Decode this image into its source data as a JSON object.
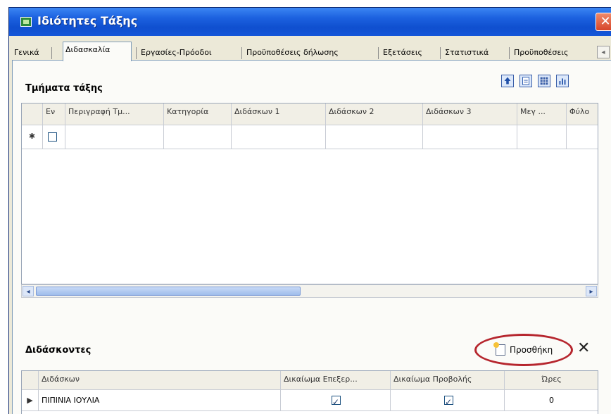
{
  "window": {
    "title": "Ιδιότητες Τάξης",
    "close_glyph": "✕"
  },
  "tabs": [
    {
      "label": "Γενικά"
    },
    {
      "label": "Διδασκαλία"
    },
    {
      "label": "Εργασίες-Πρόοδοι"
    },
    {
      "label": "Προϋποθέσεις δήλωσης"
    },
    {
      "label": "Εξετάσεις"
    },
    {
      "label": "Στατιστικά"
    },
    {
      "label": "Προϋποθέσεις"
    }
  ],
  "tabs_scroll_glyph": "◂",
  "tmimata": {
    "title": "Τμήματα τάξης",
    "columns": [
      "Εν",
      "Περιγραφή Τμ...",
      "Κατηγορία",
      "Διδάσκων 1",
      "Διδάσκων 2",
      "Διδάσκων 3",
      "Μεγ ...",
      "Φύλο"
    ],
    "new_row_marker": "✱",
    "toolbar_icons": [
      "import-icon",
      "export-icon",
      "grid-icon",
      "chart-icon"
    ]
  },
  "scrollbar": {
    "left_arrow": "◂",
    "right_arrow": "▸"
  },
  "didaskontes": {
    "title": "Διδάσκοντες",
    "add_label": "Προσθήκη",
    "delete_glyph": "✕",
    "columns": [
      "Διδάσκων",
      "Δικαίωμα Επεξερ...",
      "Δικαίωμα Προβολής",
      "Ώρες"
    ],
    "rows": [
      {
        "name": "ΠΙΠΙΝΙΑ ΙΟΥΛΙΑ",
        "edit_right": true,
        "view_right": true,
        "hours": "0"
      }
    ],
    "row_marker": "▶"
  }
}
